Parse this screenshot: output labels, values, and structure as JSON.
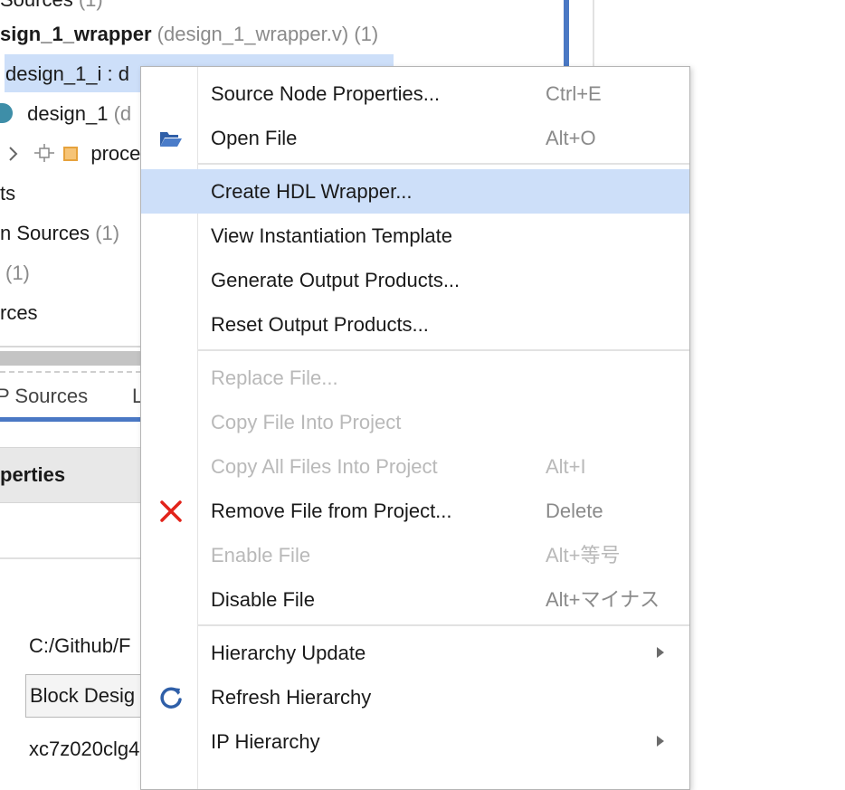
{
  "tree": {
    "row0_name": "Sources",
    "row0_count": "(1)",
    "row1_name": "sign_1_wrapper",
    "row1_file": "(design_1_wrapper.v) (1)",
    "row2_name": "design_1_i : d",
    "row3_name": "design_1",
    "row3_suffix": "(d",
    "row4_name": "proce",
    "row5_name": "ts",
    "row6_name": "n Sources",
    "row6_count": "(1)",
    "row7_count": "(1)",
    "row8_name": "rces"
  },
  "tabs": {
    "ip_sources": "P Sources",
    "other": "L"
  },
  "properties": {
    "header": "perties",
    "path_value": "C:/Github/F",
    "type_value": "Block Desig",
    "part_value": "xc7z020clg4"
  },
  "menu": {
    "items": [
      {
        "label": "Source Node Properties...",
        "shortcut": "Ctrl+E",
        "icon": ""
      },
      {
        "label": "Open File",
        "shortcut": "Alt+O",
        "icon": "folder-open-icon"
      },
      {
        "label": "Create HDL Wrapper...",
        "shortcut": "",
        "icon": ""
      },
      {
        "label": "View Instantiation Template",
        "shortcut": "",
        "icon": ""
      },
      {
        "label": "Generate Output Products...",
        "shortcut": "",
        "icon": ""
      },
      {
        "label": "Reset Output Products...",
        "shortcut": "",
        "icon": ""
      },
      {
        "label": "Replace File...",
        "shortcut": "",
        "icon": ""
      },
      {
        "label": "Copy File Into Project",
        "shortcut": "",
        "icon": ""
      },
      {
        "label": "Copy All Files Into Project",
        "shortcut": "Alt+I",
        "icon": ""
      },
      {
        "label": "Remove File from Project...",
        "shortcut": "Delete",
        "icon": "remove-x-icon"
      },
      {
        "label": "Enable File",
        "shortcut": "Alt+等号",
        "icon": ""
      },
      {
        "label": "Disable File",
        "shortcut": "Alt+マイナス",
        "icon": ""
      },
      {
        "label": "Hierarchy Update",
        "shortcut": "",
        "icon": ""
      },
      {
        "label": "Refresh Hierarchy",
        "shortcut": "",
        "icon": "refresh-icon"
      },
      {
        "label": "IP Hierarchy",
        "shortcut": "",
        "icon": ""
      }
    ]
  },
  "colors": {
    "highlight": "#cddff9",
    "accent_blue": "#4a78c4",
    "remove_red": "#e2231a",
    "disabled_text": "#b9b9b9"
  }
}
